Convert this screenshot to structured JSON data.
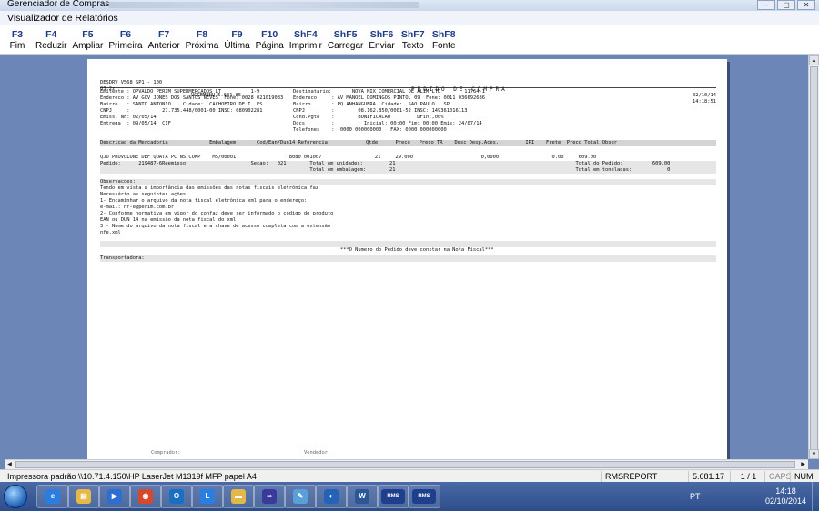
{
  "app_window": {
    "title": "Gerenciador de Compras"
  },
  "viewer_window": {
    "title": "Visualizador de Relatórios"
  },
  "toolbar": [
    {
      "key": "F3",
      "label": "Fim",
      "icon": "exit"
    },
    {
      "key": "F4",
      "label": "Reduzir",
      "icon": "zoom-out"
    },
    {
      "key": "F5",
      "label": "Ampliar",
      "icon": "zoom-in"
    },
    {
      "key": "F6",
      "label": "Primeira",
      "icon": "first-page"
    },
    {
      "key": "F7",
      "label": "Anterior",
      "icon": "previous-page"
    },
    {
      "key": "F8",
      "label": "Próxima",
      "icon": "next-page"
    },
    {
      "key": "F9",
      "label": "Última",
      "icon": "last-page"
    },
    {
      "key": "F10",
      "label": "Página",
      "icon": "page"
    },
    {
      "key": "ShF4",
      "label": "Imprimir",
      "icon": "print"
    },
    {
      "key": "ShF5",
      "label": "Carregar",
      "icon": "load"
    },
    {
      "key": "ShF6",
      "label": "Enviar",
      "icon": "send"
    },
    {
      "key": "ShF7",
      "label": "Texto",
      "icon": "text"
    },
    {
      "key": "ShF8",
      "label": "Fonte",
      "icon": "font"
    }
  ],
  "report": {
    "header": {
      "left1": "DESDRV V568 SP1 - 100",
      "left2": "03.2z",
      "left2b": "VGCBMENU 5.681.85",
      "title": "PEDIDO DE COMPRA",
      "date": "02/10/14",
      "time": "14:18:51"
    },
    "left_block": [
      "Emitente : OPVALDO PERIM SUPERMERCADOS LT          1-9",
      "Endereco : AV GOV JONES DOS SANTOS NEVES  Fone: 0028 021019083",
      "Bairro   : SANTO ANTONIO    Cidade:  CACHOEIRO DE I  ES",
      "CNPJ     :           27.735.448/0001-00 INSC: 080902281",
      "Emiss. NF: 02/05/14",
      "Entrega  : 09/05/14  CIF"
    ],
    "right_block": [
      "Destinatario:       NOVA MIX COMERCIAL DE ALIM LTD        11764-1",
      "Endereco     : AV MANOEL DOMINGOS PINTO, 09  Fone: 0011 036692686",
      "Bairro       : PQ ANHANGUERA  Cidade:  SAO PAULO   SP",
      "CNPJ         :        08.162.850/0001-52 INSC: 149361016113",
      "Cond.Pgto    :        BONIFICACAO         DFin:,00%",
      "Docs         :          Inicial: 00:00 Fim: 00:00 Emis: 24/07/14",
      "Telefones    :  0000 000000000   FAX: 0000 000000000"
    ],
    "columns_line": "Descricao da Mercadoria              Embalagem       Cod/Ean/Dun14 Referencia             Qtde      Preco   Preco TR    Desc Desp.Aces.         IPI    Frete  Preco Total Obser",
    "item_line": "QJO PROVOLONE DEF QUATA PC NS COMP    MS/00001                  8080 001007                  21     29.000                       0,0000                  0.00     609.00",
    "totals": [
      "Pedido:      219487-6Reemisso                      Secao:   021        Total em unidades:         21                                                             Total do Pedido:          609.00",
      "                                                                       Total em embalagem:        21                                                             Total em toneladas:            0"
    ],
    "obs_title": "Observacoes:",
    "obs_lines": [
      "Tendo em vista a importância das emissões das notas fiscais eletrônica faz",
      "Necessário as seguintes ações:",
      "1- Encaminhar o arquivo da nota fiscal eletrônica xml para o endereço:",
      "e-mail: nf-e@perim.com.br",
      "2- Conforme normativa em vigor do confaz deve ser informado o código do produto",
      "EAN ou DUN 14 na emissão da nota fiscal do xml",
      "3 - Nome do arquivo da nota fiscal e a chave de acesso completa com a extensão",
      "nfe.xml"
    ],
    "notice": "***O Numero do Pedido deve constar na Nota Fiscal***",
    "transport": "Transportadora:",
    "footer_left": "Comprador:",
    "footer_right": "Vendedor:"
  },
  "statusbar": {
    "printer": "Impressora padrão \\\\10.71.4.150\\HP LaserJet M1319f MFP papel A4",
    "report": "RMSREPORT",
    "version": "5.681.17",
    "page": "1 / 1",
    "caps": "CAPS",
    "num": "NUM"
  },
  "taskbar": {
    "apps": [
      {
        "name": "internet-explorer",
        "color": "#2a7de1",
        "glyph": "e"
      },
      {
        "name": "file-explorer",
        "color": "#e6b84a",
        "glyph": "▤"
      },
      {
        "name": "media-player",
        "color": "#2c6fd1",
        "glyph": "▶"
      },
      {
        "name": "chrome",
        "color": "#d9472b",
        "glyph": "◉"
      },
      {
        "name": "outlook",
        "color": "#1b6fc2",
        "glyph": "O"
      },
      {
        "name": "lync",
        "color": "#2a7de1",
        "glyph": "L"
      },
      {
        "name": "folder",
        "color": "#e2b84b",
        "glyph": "▬"
      },
      {
        "name": "network",
        "color": "#3a3a9a",
        "glyph": "∞"
      },
      {
        "name": "paint",
        "color": "#5aa0d8",
        "glyph": "✎"
      },
      {
        "name": "remote",
        "color": "#2563b8",
        "glyph": "◐"
      },
      {
        "name": "word",
        "color": "#2b5797",
        "glyph": "W"
      },
      {
        "name": "rms-1",
        "color": "#1d3f8c",
        "glyph": "RMS"
      },
      {
        "name": "rms-2",
        "color": "#1d3f8c",
        "glyph": "RMS"
      }
    ],
    "lang": "PT",
    "time": "14:18",
    "date": "02/10/2014"
  }
}
